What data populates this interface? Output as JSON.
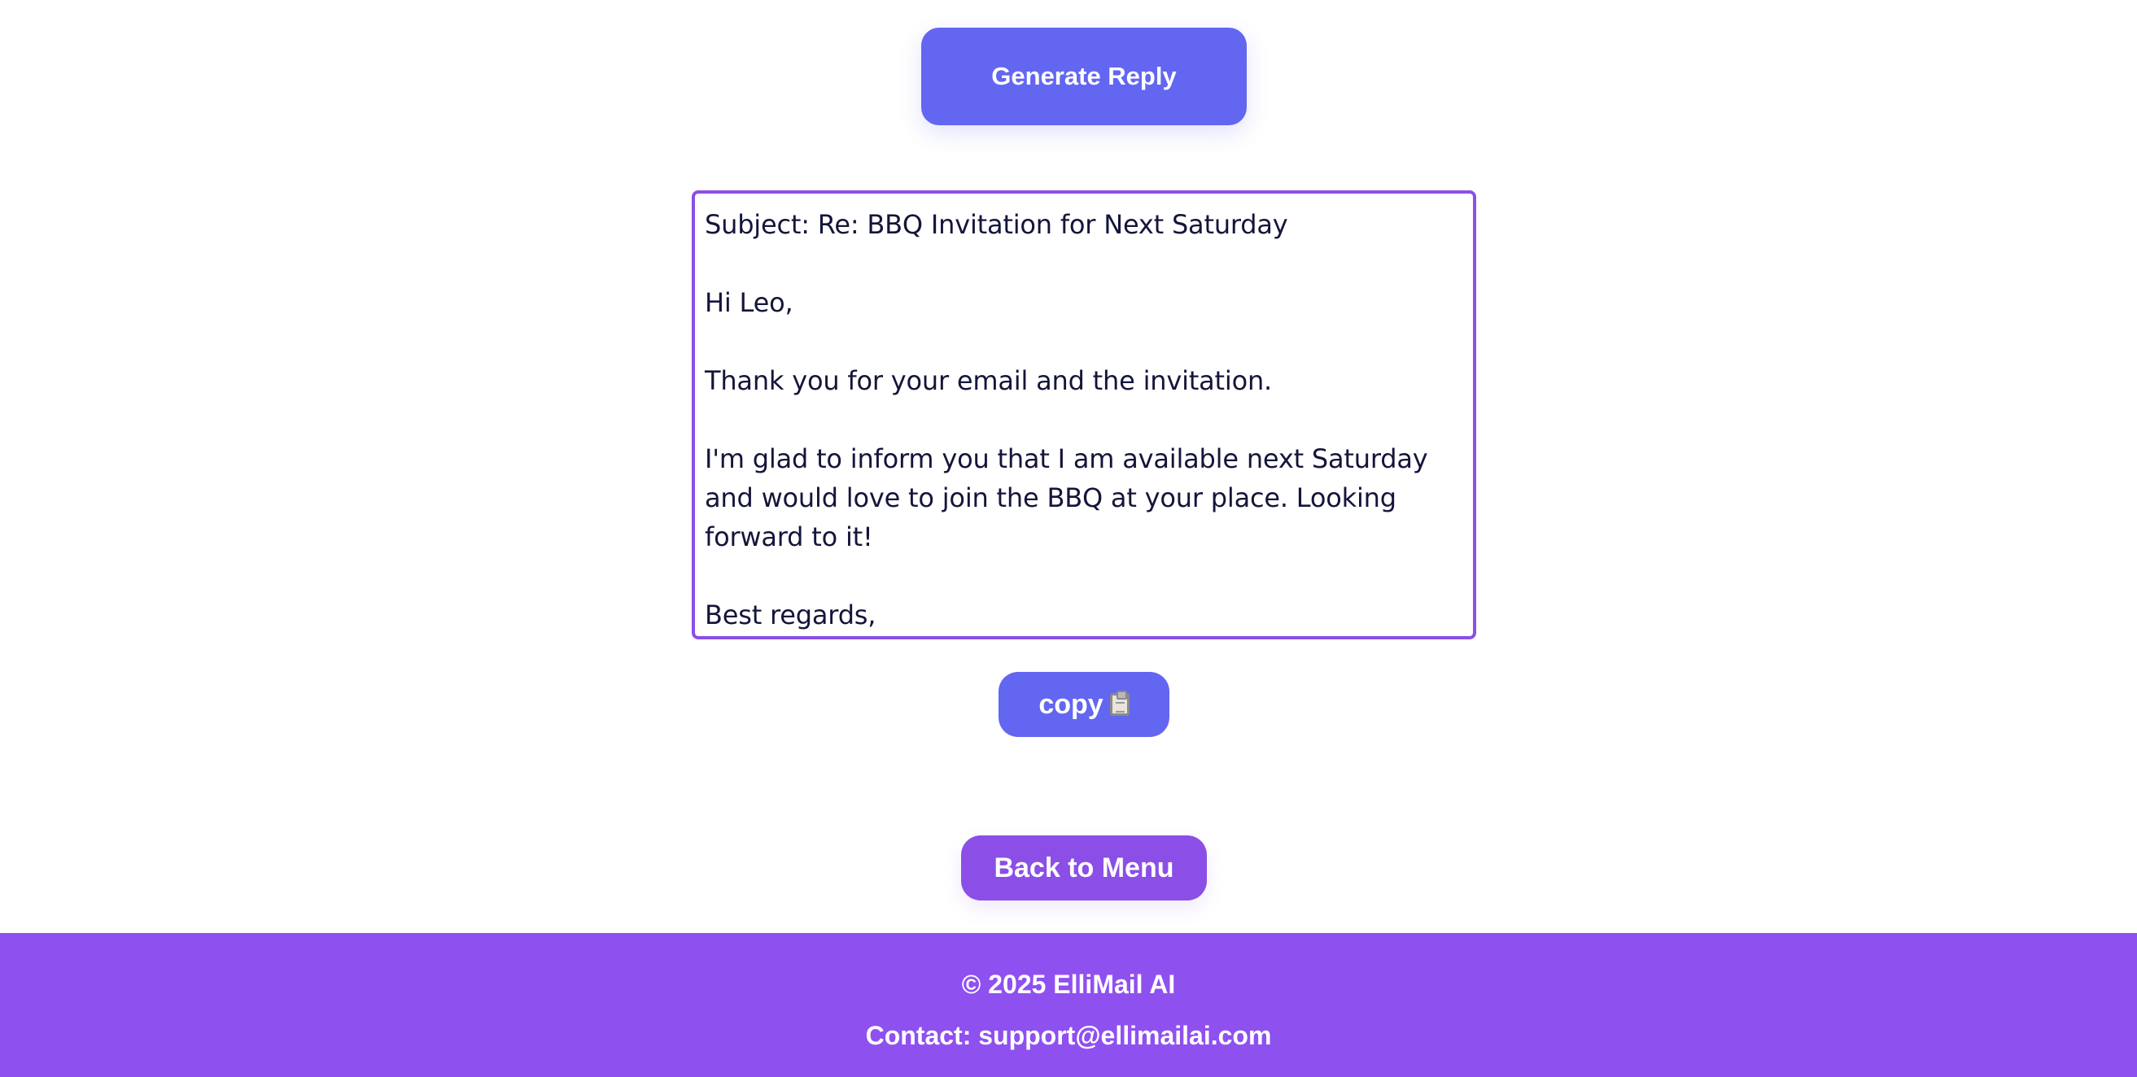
{
  "actions": {
    "generate_label": "Generate Reply",
    "copy_label": "copy",
    "back_label": "Back to Menu"
  },
  "reply": {
    "text": "Subject: Re: BBQ Invitation for Next Saturday\n\nHi Leo,\n\nThank you for your email and the invitation.\n\nI'm glad to inform you that I am available next Saturday and would love to join the BBQ at your place. Looking forward to it!\n\nBest regards,\nTom"
  },
  "footer": {
    "copyright": "© 2025 ElliMail AI",
    "contact": "Contact: support@ellimailai.com"
  },
  "theme": {
    "primary_button": "#6366f1",
    "secondary_button": "#8b4fe7",
    "footer_bg": "#8f50f0",
    "text": "#14153a"
  },
  "icons": {
    "copy_icon": "clipboard-icon"
  }
}
